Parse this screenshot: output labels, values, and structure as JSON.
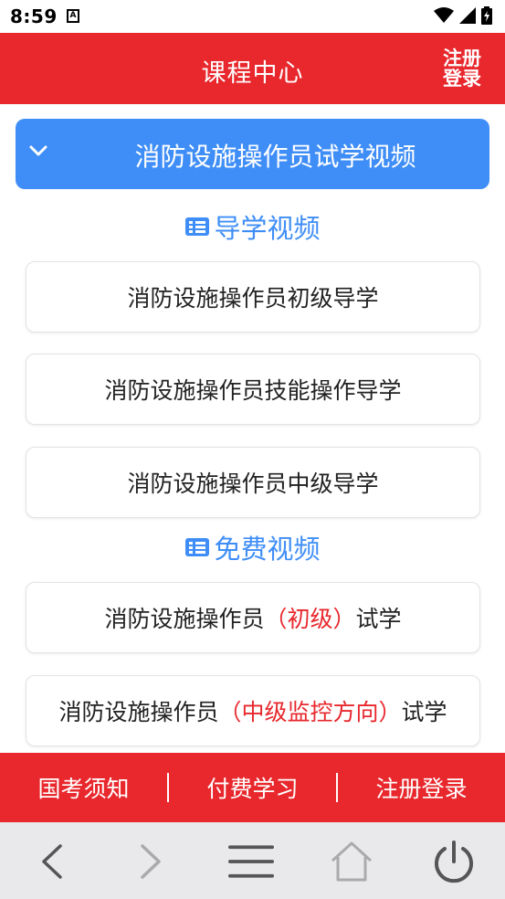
{
  "status": {
    "time": "8:59",
    "notif": "A"
  },
  "header": {
    "title": "课程中心",
    "login_top": "注册",
    "login_bottom": "登录"
  },
  "category": {
    "title": "消防设施操作员试学视频"
  },
  "sections": {
    "guide": {
      "title": "导学视频"
    },
    "free": {
      "title": "免费视频"
    }
  },
  "guide_items": [
    "消防设施操作员初级导学",
    "消防设施操作员技能操作导学",
    "消防设施操作员中级导学"
  ],
  "free_items": [
    {
      "prefix": "消防设施操作员",
      "level": "（初级）",
      "suffix": "试学"
    },
    {
      "prefix": "消防设施操作员",
      "level": "（中级监控方向）",
      "suffix": "试学"
    }
  ],
  "bottomnav": {
    "notice": "国考须知",
    "paid": "付费学习",
    "register": "注册登录"
  },
  "colors": {
    "brand_red": "#e8282d",
    "accent_blue": "#3f8ef7"
  }
}
